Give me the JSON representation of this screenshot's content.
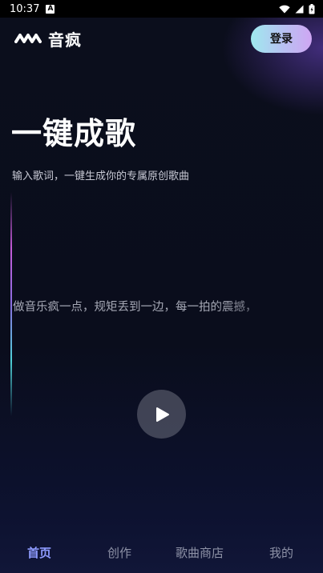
{
  "status_bar": {
    "time": "10:37",
    "notification_icon": "A",
    "icons": [
      "wifi-icon",
      "signal-icon",
      "battery-icon"
    ]
  },
  "header": {
    "brand_name": "音疯",
    "logo_icon": "wave-logo-icon",
    "login_label": "登录"
  },
  "hero": {
    "title": "一键成歌",
    "subtitle": "输入歌词，一键生成你的专属原创歌曲",
    "lyric": "做音乐疯一点，规矩丢到一边，每一拍的震撼，"
  },
  "player": {
    "play_icon": "play-icon"
  },
  "bottom_nav": {
    "items": [
      {
        "label": "首页",
        "active": true
      },
      {
        "label": "创作",
        "active": false
      },
      {
        "label": "歌曲商店",
        "active": false
      },
      {
        "label": "我的",
        "active": false
      }
    ]
  },
  "colors": {
    "background": "#0b0e1c",
    "login_gradient_start": "#9fe9ee",
    "login_gradient_end": "#cfa6f3",
    "nav_active": "#8e9bff",
    "nav_inactive": "#8d91a6"
  }
}
